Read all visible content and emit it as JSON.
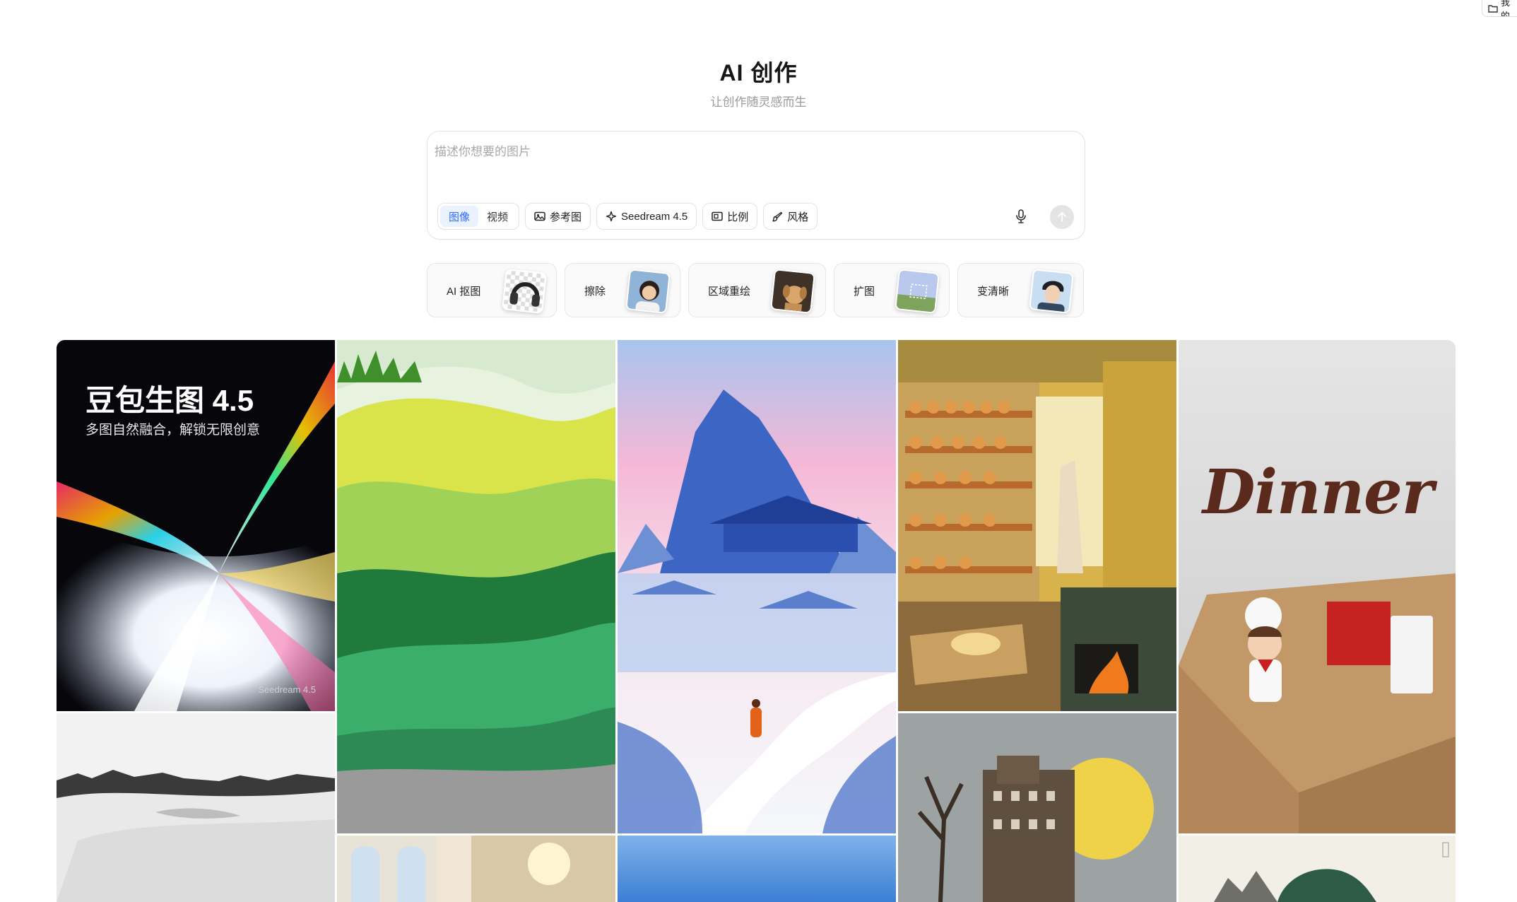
{
  "top_chip": {
    "label": "我的",
    "icon": "folder-icon"
  },
  "header": {
    "title": "AI 创作",
    "subtitle": "让创作随灵感而生"
  },
  "prompt": {
    "placeholder": "描述你想要的图片",
    "value": "",
    "mode_tabs": [
      {
        "label": "图像",
        "active": true
      },
      {
        "label": "视频",
        "active": false
      }
    ],
    "reference_label": "参考图",
    "model_label": "Seedream 4.5",
    "ratio_label": "比例",
    "style_label": "风格",
    "mic_icon": "microphone-icon",
    "send_icon": "arrow-up-icon"
  },
  "tools": [
    {
      "label": "AI 抠图"
    },
    {
      "label": "擦除"
    },
    {
      "label": "区域重绘"
    },
    {
      "label": "扩图"
    },
    {
      "label": "变清晰"
    }
  ],
  "gallery": {
    "hero": {
      "title": "豆包生图 4.5",
      "subtitle": "多图自然融合，解锁无限创意",
      "brand": "Seedream 4.5"
    },
    "dinner": {
      "word": "Dinner"
    }
  },
  "colors": {
    "accent": "#2f6bff",
    "accent_bg": "#eaf1ff",
    "border": "#e3e3e3"
  }
}
